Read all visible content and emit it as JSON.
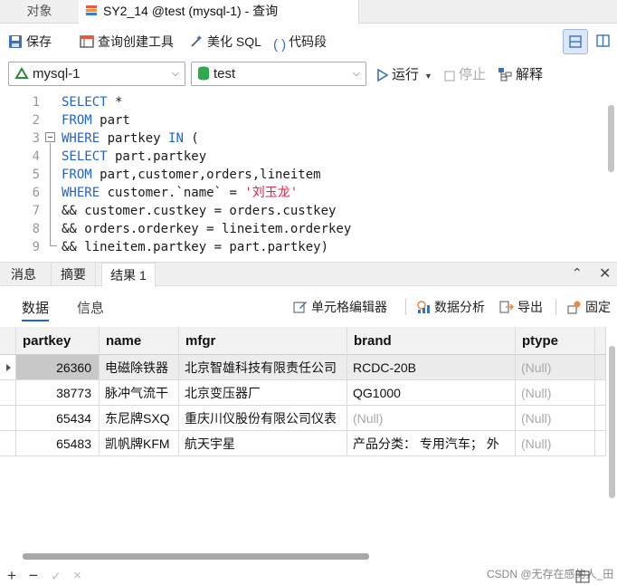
{
  "tabs": {
    "objects": "对象",
    "query": "SY2_14 @test (mysql-1) - 查询"
  },
  "toolbar": {
    "save": "保存",
    "query_builder": "查询创建工具",
    "beautify": "美化 SQL",
    "snippet": "代码段"
  },
  "selectors": {
    "connection": "mysql-1",
    "database": "test",
    "run": "运行",
    "stop": "停止",
    "explain": "解释"
  },
  "editor": {
    "line_numbers": [
      "1",
      "2",
      "3",
      "4",
      "5",
      "6",
      "7",
      "8",
      "9"
    ],
    "lines": [
      [
        {
          "t": "SELECT",
          "k": "kw"
        },
        {
          "t": " *",
          "k": ""
        }
      ],
      [
        {
          "t": "FROM",
          "k": "kw"
        },
        {
          "t": " part",
          "k": ""
        }
      ],
      [
        {
          "t": "WHERE",
          "k": "kw"
        },
        {
          "t": " partkey ",
          "k": ""
        },
        {
          "t": "IN",
          "k": "kw"
        },
        {
          "t": " (",
          "k": ""
        }
      ],
      [
        {
          "t": "SELECT",
          "k": "kw"
        },
        {
          "t": " part.partkey",
          "k": ""
        }
      ],
      [
        {
          "t": "FROM",
          "k": "kw"
        },
        {
          "t": " part,customer,orders,lineitem",
          "k": ""
        }
      ],
      [
        {
          "t": "WHERE",
          "k": "kw"
        },
        {
          "t": " customer.`name` = ",
          "k": ""
        },
        {
          "t": "'刘玉龙'",
          "k": "str"
        }
      ],
      [
        {
          "t": "&& customer.custkey = orders.custkey",
          "k": ""
        }
      ],
      [
        {
          "t": "&& orders.orderkey = lineitem.orderkey",
          "k": ""
        }
      ],
      [
        {
          "t": "&& lineitem.partkey = part.partkey)",
          "k": ""
        }
      ]
    ]
  },
  "panel": {
    "tabs": [
      "消息",
      "摘要",
      "结果 1"
    ]
  },
  "result_toolbar": {
    "data": "数据",
    "info": "信息",
    "cell_editor": "单元格编辑器",
    "data_analysis": "数据分析",
    "export": "导出",
    "pin": "固定"
  },
  "grid": {
    "columns": [
      "partkey",
      "name",
      "mfgr",
      "brand",
      "ptype"
    ],
    "rows": [
      [
        "26360",
        "电磁除铁器",
        "北京智雄科技有限责任公司",
        "RCDC-20B",
        "(Null)"
      ],
      [
        "38773",
        "脉冲气流干",
        "北京变压器厂",
        "QG1000",
        "(Null)"
      ],
      [
        "65434",
        "东尼牌SXQ",
        "重庆川仪股份有限公司仪表",
        "(Null)",
        "(Null)"
      ],
      [
        "65483",
        "凯帆牌KFM",
        "航天宇星",
        "产品分类：  专用汽车；  外",
        "(Null)"
      ]
    ]
  },
  "footer": {
    "add": "+",
    "remove": "−",
    "apply": "✓",
    "discard": "×",
    "watermark": "CSDN @无存在感的人_田"
  },
  "colors": {
    "accent": "#1e63d6",
    "string": "#e0224a",
    "null": "#a9a9a9"
  }
}
